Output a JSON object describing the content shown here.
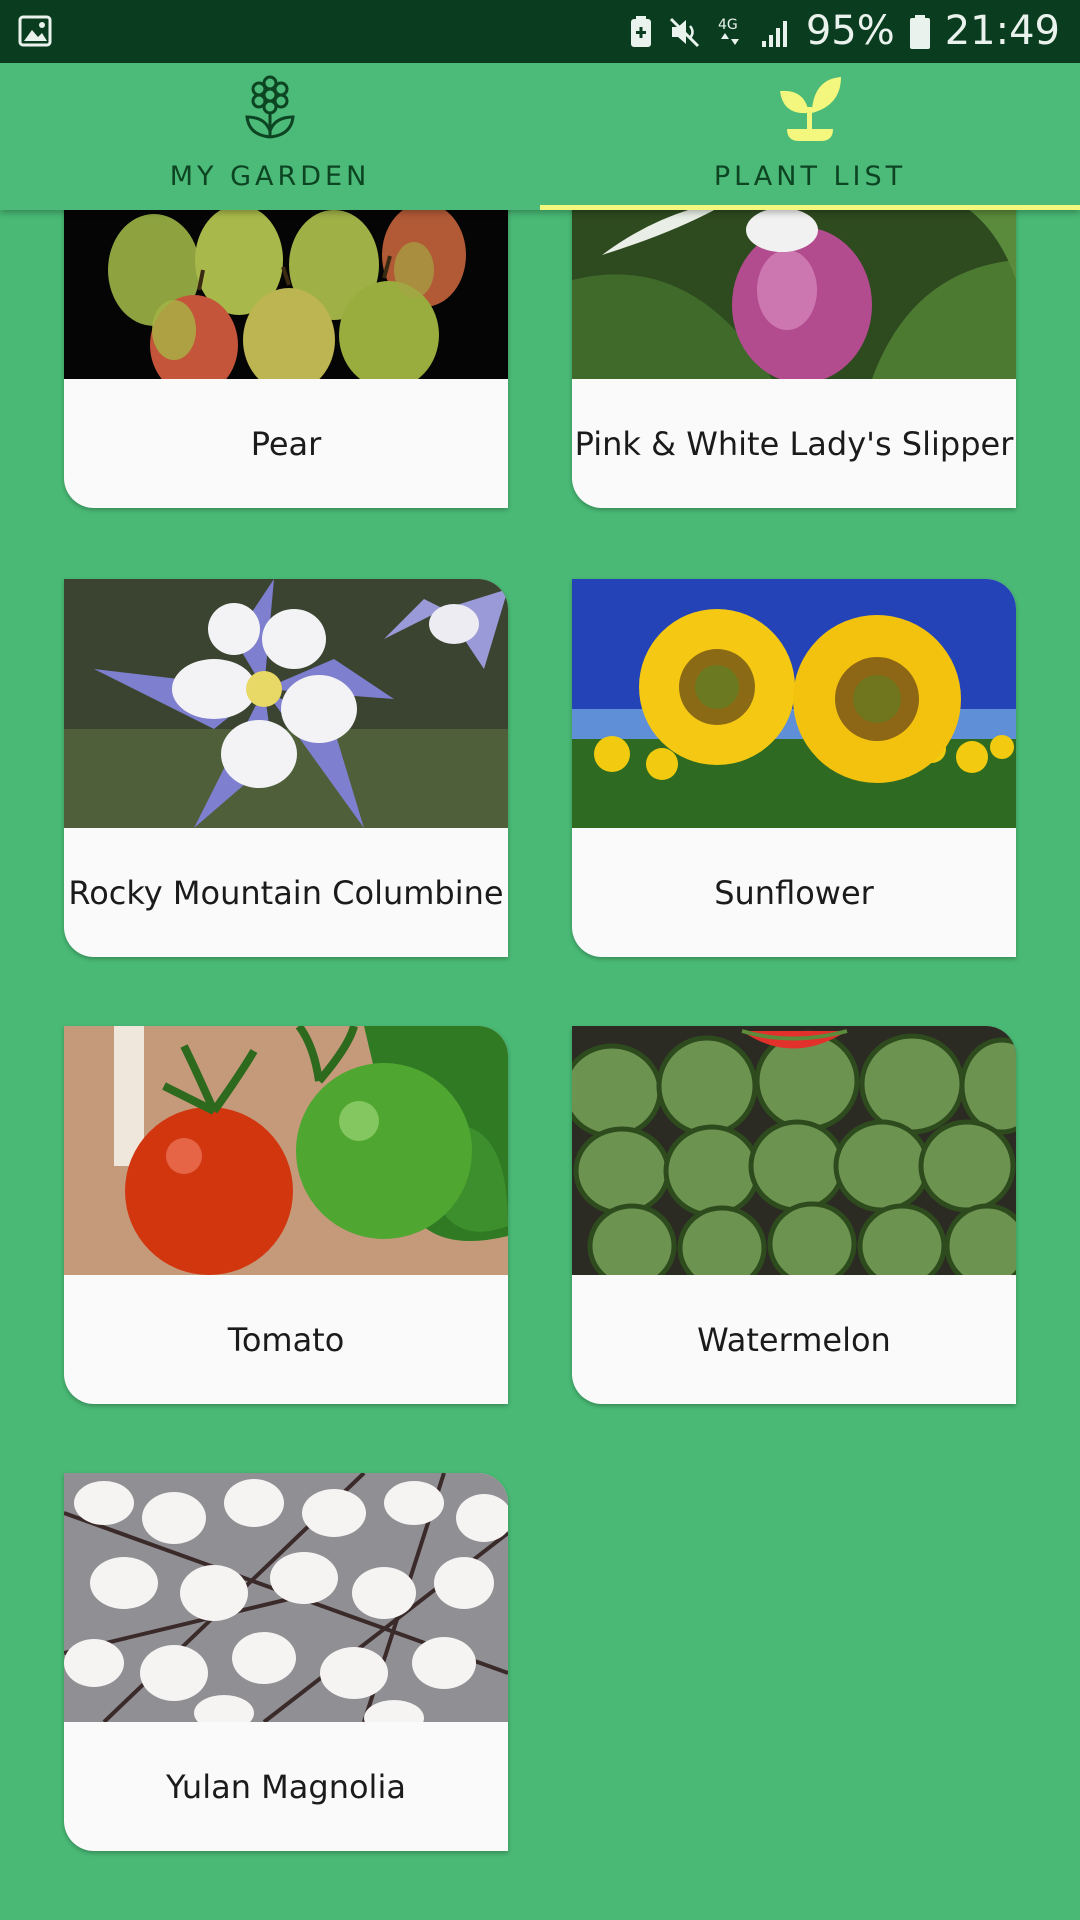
{
  "status_bar": {
    "battery": "95%",
    "time": "21:49",
    "network": "4G"
  },
  "tabs": [
    {
      "label": "MY GARDEN",
      "icon": "flower-icon",
      "selected": false
    },
    {
      "label": "PLANT LIST",
      "icon": "sprout-icon",
      "selected": true
    }
  ],
  "colors": {
    "background": "#49b975",
    "status_bar": "#0a3c1f",
    "tab_text": "#0d4422",
    "selected_icon": "#f3f77d",
    "card": "#fafafa"
  },
  "plants": [
    {
      "name": "Pear"
    },
    {
      "name": "Pink & White Lady's Slipper"
    },
    {
      "name": "Rocky Mountain Columbine"
    },
    {
      "name": "Sunflower"
    },
    {
      "name": "Tomato"
    },
    {
      "name": "Watermelon"
    },
    {
      "name": "Yulan Magnolia"
    }
  ]
}
